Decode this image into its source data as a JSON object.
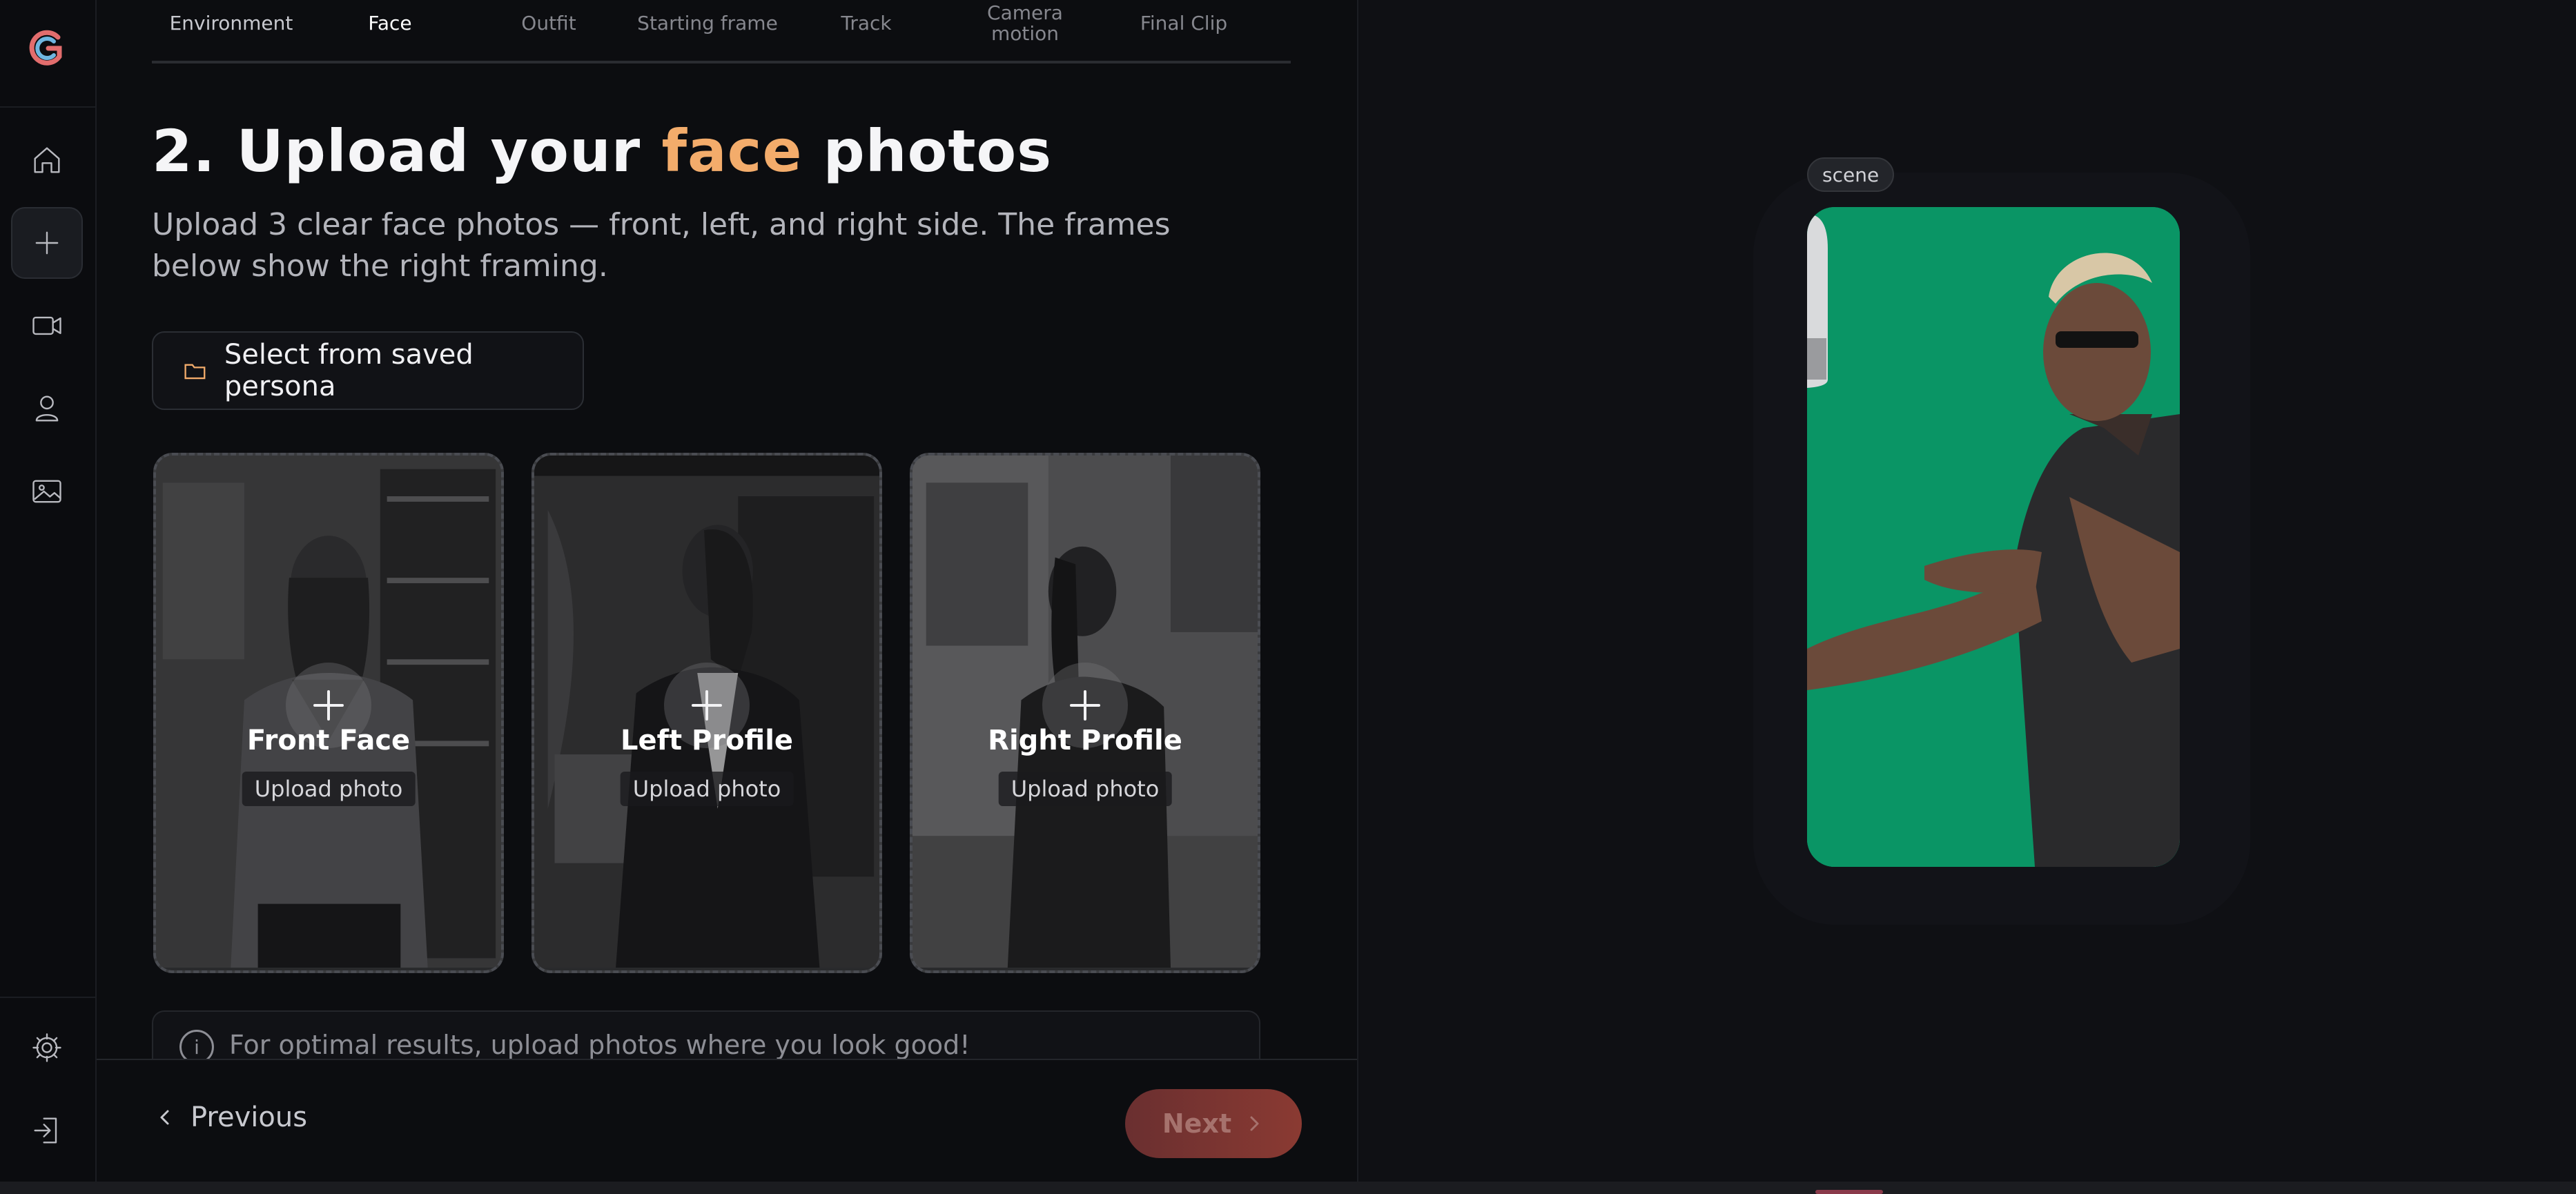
{
  "steps": [
    {
      "label": "Environment",
      "state": "done"
    },
    {
      "label": "Face",
      "state": "current"
    },
    {
      "label": "Outfit",
      "state": "upcoming"
    },
    {
      "label": "Starting frame",
      "state": "upcoming"
    },
    {
      "label": "Track",
      "state": "upcoming"
    },
    {
      "label": "Camera motion",
      "state": "upcoming"
    },
    {
      "label": "Final Clip",
      "state": "upcoming"
    }
  ],
  "heading": {
    "prefix": "2. Upload your ",
    "accent": "face",
    "suffix": " photos",
    "subtitle": "Upload 3 clear face photos — front, left, and right side. The frames below show the right framing."
  },
  "persona_button": {
    "label": "Select from saved persona",
    "icon": "folder-icon"
  },
  "cards": [
    {
      "title": "Front Face",
      "action": "Upload photo"
    },
    {
      "title": "Left Profile",
      "action": "Upload photo"
    },
    {
      "title": "Right Profile",
      "action": "Upload photo"
    }
  ],
  "info": {
    "text": "For optimal results, upload photos where you look good!"
  },
  "footer": {
    "previous": "Previous",
    "next": "Next"
  },
  "preview": {
    "chip": "scene"
  },
  "rail": {
    "icons": [
      "home-icon",
      "plus-icon",
      "video-icon",
      "user-icon",
      "image-icon",
      "gear-icon",
      "logout-icon"
    ]
  },
  "colors": {
    "accent": "#f3ac6b",
    "background": "#0c0d10",
    "next_button": "#7a3431",
    "green_screen": "#0a9a68"
  }
}
